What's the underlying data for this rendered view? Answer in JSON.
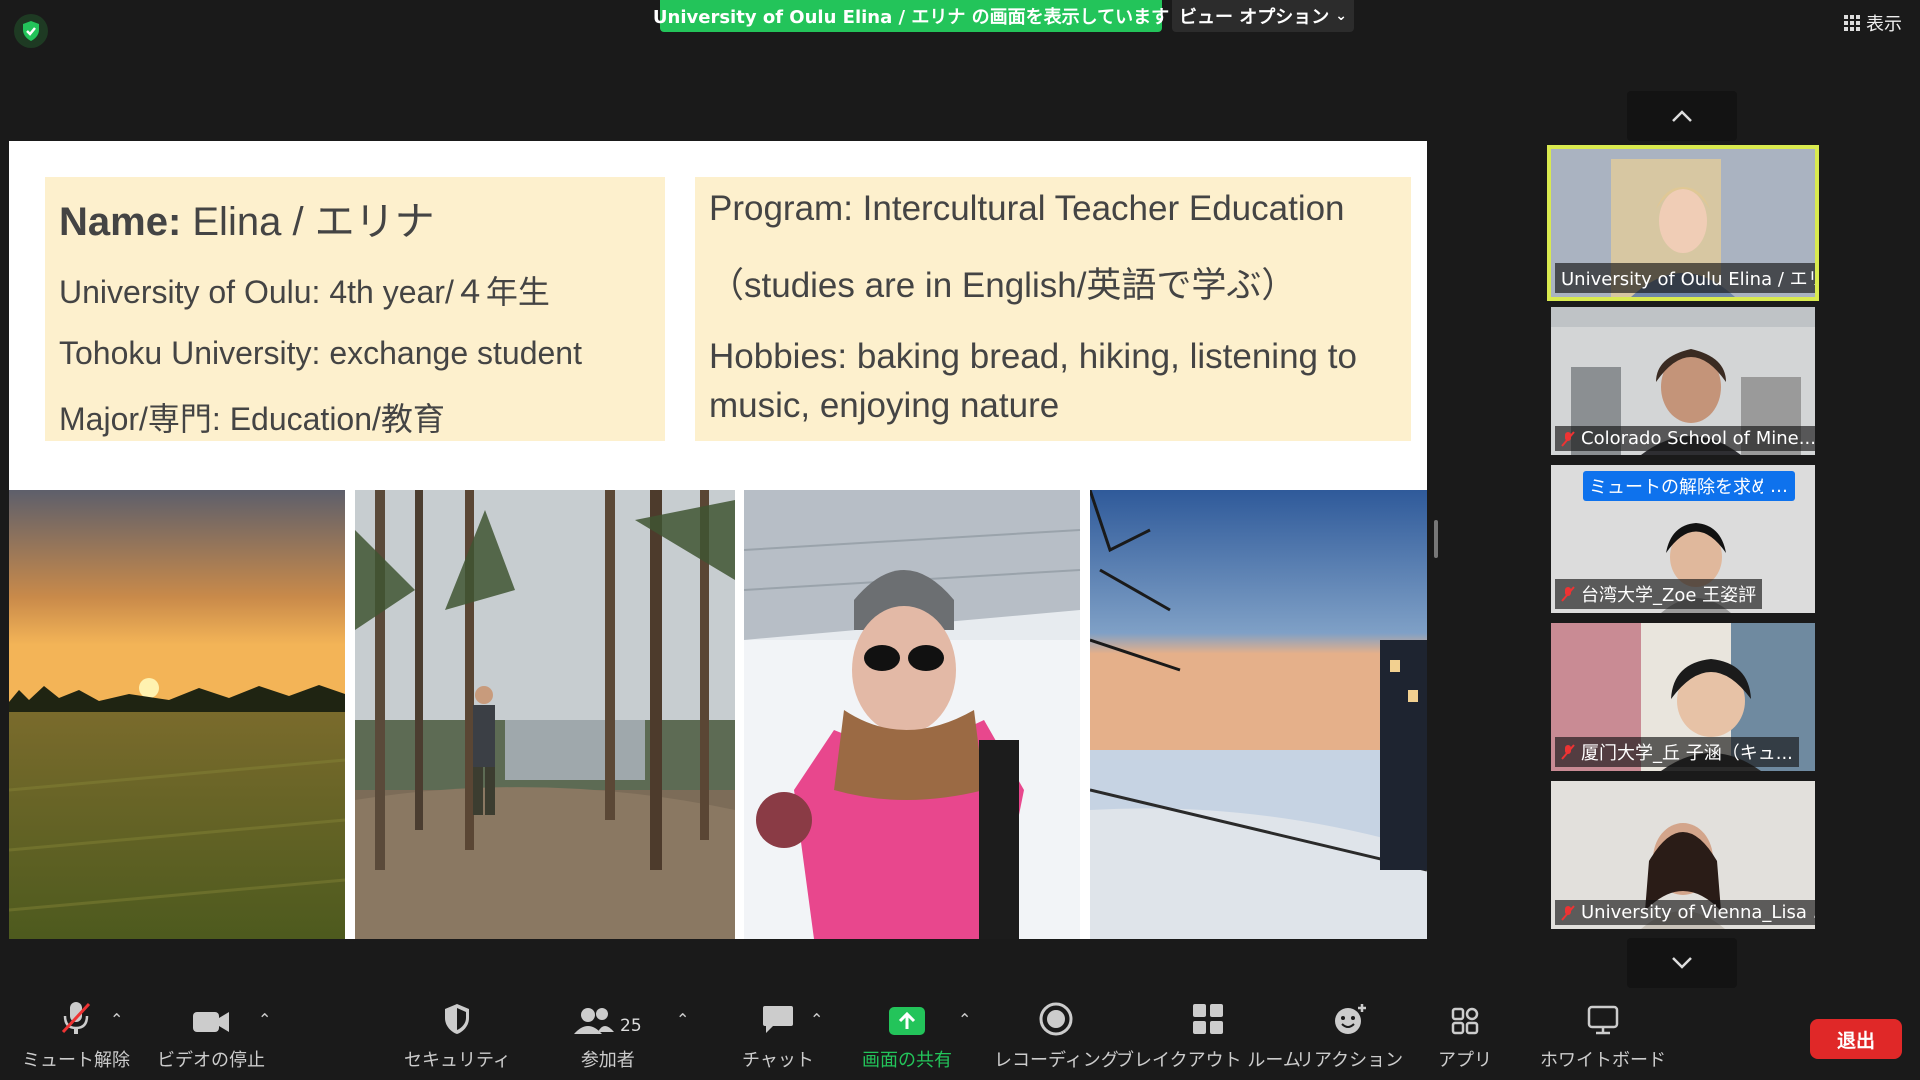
{
  "top": {
    "share_banner": "University of Oulu Elina / エリナ の画面を表示しています",
    "view_options": "ビュー オプション",
    "display_label": "表示",
    "security_color": "#23c45a"
  },
  "slide": {
    "left_box": {
      "name_label": "Name:",
      "name_value": " Elina / エリナ",
      "university": "University of Oulu: 4th year/４年生",
      "exchange": "Tohoku University: exchange student",
      "major": "Major/専門: Education/教育"
    },
    "right_box": {
      "program": "Program: Intercultural Teacher Education",
      "studies": "（studies are in English/英語で学ぶ）",
      "hobbies": "Hobbies: baking bread, hiking, listening to music, enjoying nature"
    },
    "photos": [
      "sunset-field",
      "forest-lake-hiker",
      "winter-selfie",
      "frozen-waterfront-dusk"
    ]
  },
  "participants": [
    {
      "name": "University of Oulu Elina / エリ...",
      "muted": false,
      "active": true
    },
    {
      "name": "Colorado School of Mine...",
      "muted": true,
      "active": false
    },
    {
      "name": "台湾大学_Zoe 王姿評",
      "muted": true,
      "active": false
    },
    {
      "name": "厦门大学_丘 子涵（キュ...",
      "muted": true,
      "active": false
    },
    {
      "name": "University of Vienna_Lisa ...",
      "muted": true,
      "active": false
    }
  ],
  "unmute_request": "ミュートの解除を求める",
  "more_label": "…",
  "toolbar": {
    "unmute": "ミュート解除",
    "stop_video": "ビデオの停止",
    "security": "セキュリティ",
    "participants": "参加者",
    "participant_count": "25",
    "chat": "チャット",
    "share": "画面の共有",
    "recording": "レコーディング",
    "breakout": "ブレイクアウト ルーム",
    "reactions": "リアクション",
    "apps": "アプリ",
    "whiteboard": "ホワイトボード",
    "leave": "退出"
  }
}
